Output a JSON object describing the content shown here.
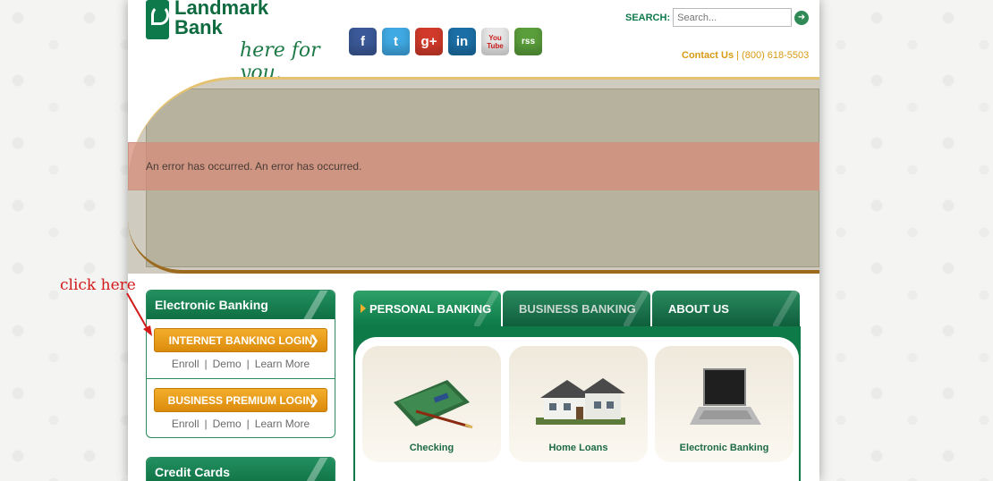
{
  "brand": {
    "name_line1": "Landmark",
    "name_line2": "Bank",
    "tagline": "here for you."
  },
  "social": [
    {
      "name": "facebook",
      "glyph": "f",
      "color": "#3b5998"
    },
    {
      "name": "twitter",
      "glyph": "t",
      "color": "#3fa9e3"
    },
    {
      "name": "google-plus",
      "glyph": "g+",
      "color": "#d13a2a"
    },
    {
      "name": "linkedin",
      "glyph": "in",
      "color": "#1b6fa6"
    },
    {
      "name": "youtube",
      "glyph": "You Tube",
      "color": "#e7e7e7"
    },
    {
      "name": "rss",
      "glyph": "rss",
      "color": "#5a9e3b"
    }
  ],
  "search": {
    "label": "SEARCH:",
    "placeholder": "Search..."
  },
  "contact": {
    "label": "Contact Us",
    "separator": " | ",
    "phone": "(800) 618-5503"
  },
  "error": {
    "message": "An error has occurred. An error has occurred."
  },
  "electronic_banking": {
    "title": "Electronic Banking",
    "internet_login": "INTERNET BANKING LOGIN",
    "internet_links": {
      "enroll": "Enroll",
      "demo": "Demo",
      "learn": "Learn More"
    },
    "business_login": "BUSINESS PREMIUM LOGIN",
    "business_links": {
      "enroll": "Enroll",
      "demo": "Demo",
      "learn": "Learn More"
    }
  },
  "credit_cards": {
    "title": "Credit Cards"
  },
  "tabs": [
    {
      "label": "PERSONAL BANKING",
      "active": true
    },
    {
      "label": "BUSINESS BANKING",
      "active": false
    },
    {
      "label": "ABOUT US",
      "active": false
    }
  ],
  "tiles": [
    {
      "label": "Checking",
      "icon": "checkbook-icon"
    },
    {
      "label": "Home Loans",
      "icon": "house-icon"
    },
    {
      "label": "Electronic Banking",
      "icon": "laptop-icon"
    }
  ],
  "annotation": {
    "text": "click here"
  },
  "colors": {
    "brand_green": "#0e7a4c",
    "accent_orange": "#e89a16",
    "error_bg": "#d68c78"
  }
}
